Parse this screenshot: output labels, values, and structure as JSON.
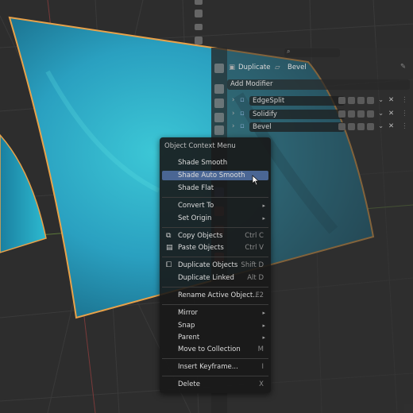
{
  "properties_panel": {
    "breadcrumb_object": "Duplicate",
    "breadcrumb_data": "Bevel",
    "add_modifier_label": "Add Modifier",
    "modifiers": [
      {
        "name": "EdgeSplit"
      },
      {
        "name": "Solidify"
      },
      {
        "name": "Bevel"
      }
    ]
  },
  "context_menu": {
    "title": "Object Context Menu",
    "items": [
      {
        "label": "Shade Smooth",
        "shortcut": "",
        "submenu": false,
        "icon": ""
      },
      {
        "label": "Shade Auto Smooth",
        "shortcut": "",
        "submenu": false,
        "icon": "",
        "highlighted": true
      },
      {
        "label": "Shade Flat",
        "shortcut": "",
        "submenu": false,
        "icon": ""
      },
      {
        "label": "Convert To",
        "shortcut": "",
        "submenu": true,
        "icon": ""
      },
      {
        "label": "Set Origin",
        "shortcut": "",
        "submenu": true,
        "icon": ""
      },
      {
        "label": "Copy Objects",
        "shortcut": "Ctrl C",
        "submenu": false,
        "icon": "copy-icon"
      },
      {
        "label": "Paste Objects",
        "shortcut": "Ctrl V",
        "submenu": false,
        "icon": "paste-icon"
      },
      {
        "label": "Duplicate Objects",
        "shortcut": "Shift D",
        "submenu": false,
        "icon": "duplicate-icon"
      },
      {
        "label": "Duplicate Linked",
        "shortcut": "Alt D",
        "submenu": false,
        "icon": ""
      },
      {
        "label": "Rename Active Object...",
        "shortcut": "F2",
        "submenu": false,
        "icon": ""
      },
      {
        "label": "Mirror",
        "shortcut": "",
        "submenu": true,
        "icon": ""
      },
      {
        "label": "Snap",
        "shortcut": "",
        "submenu": true,
        "icon": ""
      },
      {
        "label": "Parent",
        "shortcut": "",
        "submenu": true,
        "icon": ""
      },
      {
        "label": "Move to Collection",
        "shortcut": "M",
        "submenu": false,
        "icon": ""
      },
      {
        "label": "Insert Keyframe...",
        "shortcut": "I",
        "submenu": false,
        "icon": ""
      },
      {
        "label": "Delete",
        "shortcut": "X",
        "submenu": false,
        "icon": ""
      }
    ]
  },
  "colors": {
    "background": "#2d2d2d",
    "object_surface": "#2fa6c4",
    "selection_outline": "#e8a24a",
    "menu_highlight": "#4a6694"
  }
}
